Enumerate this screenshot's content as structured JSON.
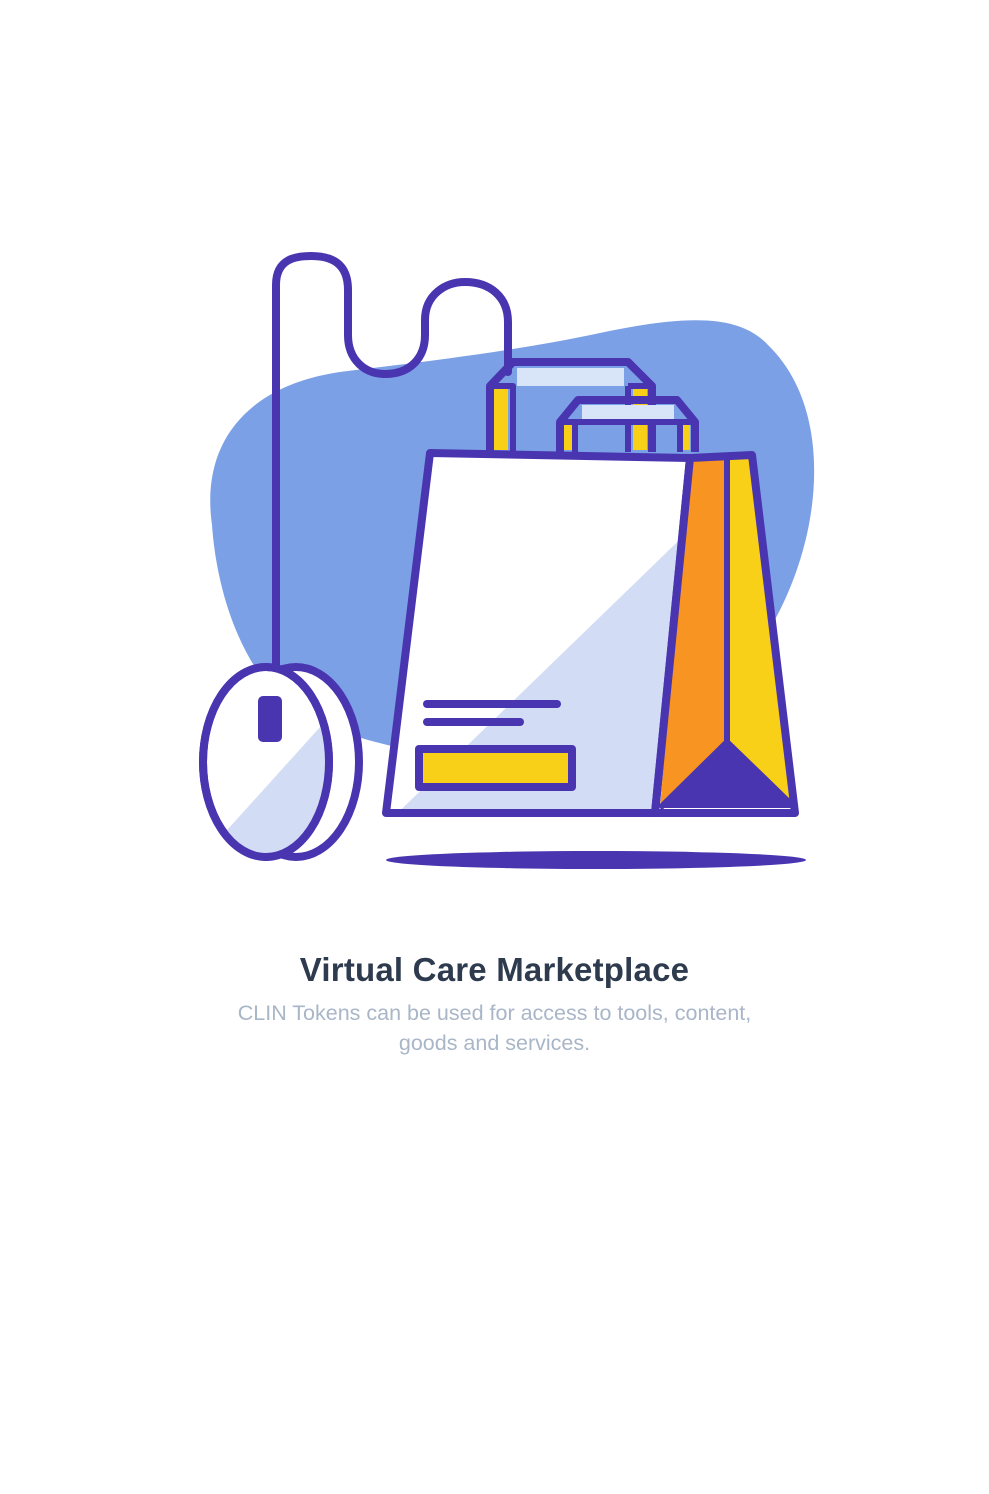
{
  "screen": {
    "title": "Virtual Care Marketplace",
    "subtitle": "CLIN Tokens can be used for access to tools, content, goods and services."
  },
  "illustration": {
    "icons": [
      "computer-mouse-icon",
      "shopping-bag-icon"
    ],
    "colors": {
      "outline": "#4a35b0",
      "blob": "#7ba0e6",
      "light_fill": "#d2ddf5",
      "white_fill": "#ffffff",
      "yellow": "#f9d018",
      "orange": "#f79422",
      "handle_fill": "#d8e4f7"
    }
  }
}
